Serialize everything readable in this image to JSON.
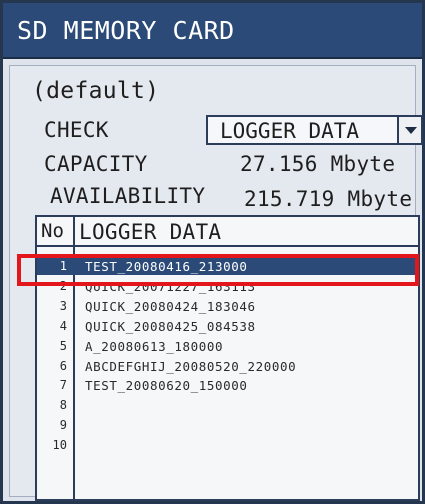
{
  "window": {
    "title": "SD MEMORY CARD"
  },
  "mode": "(default)",
  "check": {
    "label": "CHECK",
    "value": "LOGGER DATA"
  },
  "capacity": {
    "label": "CAPACITY",
    "value": "27.156 Mbyte"
  },
  "availability": {
    "label": "AVAILABILITY",
    "value": "215.719 Mbyte"
  },
  "list": {
    "columns": {
      "no": "No",
      "name": "LOGGER DATA"
    },
    "rows": [
      {
        "no": "1",
        "name": "TEST_20080416_213000",
        "selected": true
      },
      {
        "no": "2",
        "name": "QUICK_20071227_163113",
        "selected": false
      },
      {
        "no": "3",
        "name": "QUICK_20080424_183046",
        "selected": false
      },
      {
        "no": "4",
        "name": "QUICK_20080425_084538",
        "selected": false
      },
      {
        "no": "5",
        "name": "A_20080613_180000",
        "selected": false
      },
      {
        "no": "6",
        "name": "ABCDEFGHIJ_20080520_220000",
        "selected": false
      },
      {
        "no": "7",
        "name": "TEST_20080620_150000",
        "selected": false
      },
      {
        "no": "8",
        "name": "",
        "selected": false
      },
      {
        "no": "9",
        "name": "",
        "selected": false
      },
      {
        "no": "10",
        "name": "",
        "selected": false
      }
    ]
  },
  "colors": {
    "title_bar": "#2b4a78",
    "selection": "#2b4a78",
    "highlight_box": "#e3161b",
    "panel": "#e4e8ef"
  }
}
